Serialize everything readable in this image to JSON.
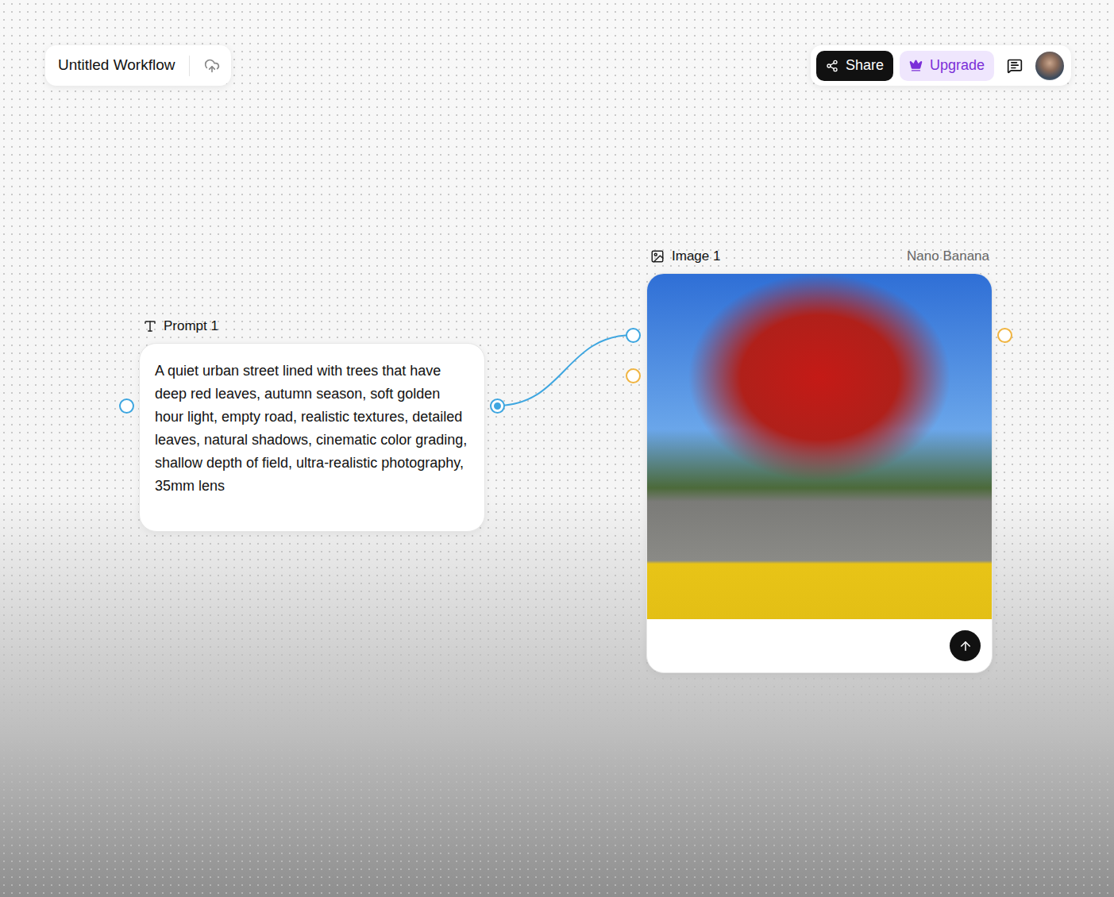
{
  "workflow": {
    "title": "Untitled Workflow"
  },
  "toolbar": {
    "share": "Share",
    "upgrade": "Upgrade"
  },
  "nodes": {
    "prompt": {
      "label": "Prompt 1",
      "text": "A quiet urban street lined with trees that have deep red leaves, autumn season, soft golden hour light, empty road, realistic textures, detailed leaves, natural shadows, cinematic color grading, shallow depth of field, ultra-realistic photography, 35mm lens",
      "inputs": [
        {
          "color": "#3ea6e0",
          "filled": false
        }
      ],
      "outputs": [
        {
          "color": "#3ea6e0",
          "filled": true
        }
      ]
    },
    "image": {
      "label": "Image 1",
      "model": "Nano Banana",
      "inputs": [
        {
          "color": "#3ea6e0",
          "filled": false
        },
        {
          "color": "#f0b440",
          "filled": false
        }
      ],
      "outputs": [
        {
          "color": "#f0b440",
          "filled": false
        }
      ]
    }
  }
}
